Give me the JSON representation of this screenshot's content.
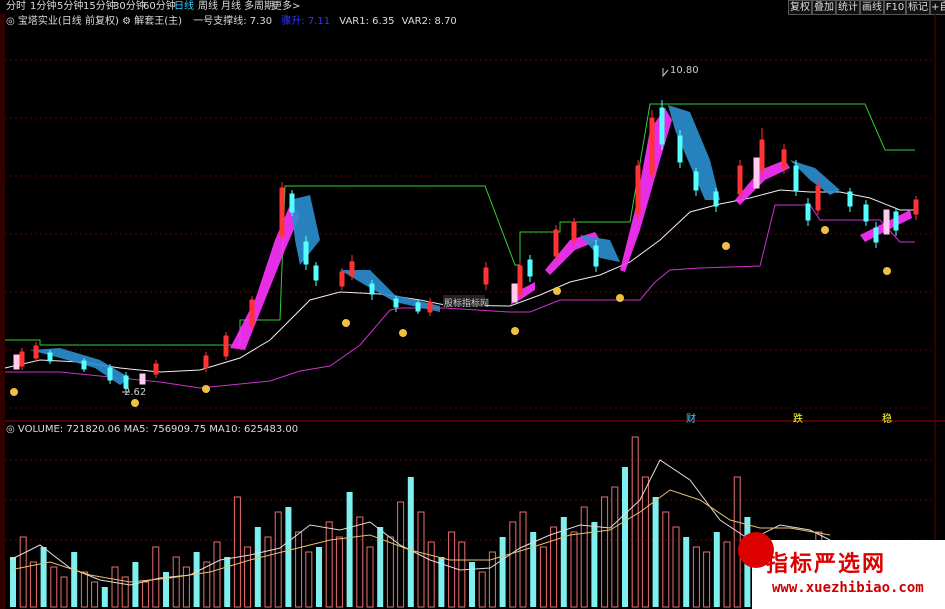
{
  "toolbar": {
    "timeframes": [
      "分时",
      "1分钟",
      "5分钟",
      "15分钟",
      "30分钟",
      "60分钟",
      "日线",
      "周线",
      "月线",
      "多周期",
      "更多>"
    ],
    "active": "日线",
    "buttons": [
      "复权",
      "叠加",
      "统计",
      "画线",
      "F10",
      "标记",
      "+自选"
    ]
  },
  "info": {
    "stock": "宝塔实业(日线 前复权)",
    "indicator": "解套王(主)",
    "support_label": "一号支撑线:",
    "support_value": "7.30",
    "second_label": "骤升:",
    "second_value": "7.11",
    "var1": "VAR1: 6.35",
    "var2": "VAR2: 8.70"
  },
  "volume": {
    "label": "VOLUME: 721820.06",
    "ma5": "MA5: 756909.75",
    "ma10": "MA10: 625483.00"
  },
  "annotations": {
    "high": "10.80",
    "low": "2.62",
    "watermark_center": "股标指标网",
    "cai": "财",
    "die": "跌",
    "wen": "稳"
  },
  "watermark": {
    "title": "指标严选网",
    "url": "www.xuezhibiao.com"
  },
  "colors": {
    "up": "#ff3333",
    "down": "#55ffff",
    "magenta": "#ff33ff",
    "blue": "#2a8fd0",
    "green_line": "#33cc33",
    "purple_line": "#cc33cc"
  }
}
